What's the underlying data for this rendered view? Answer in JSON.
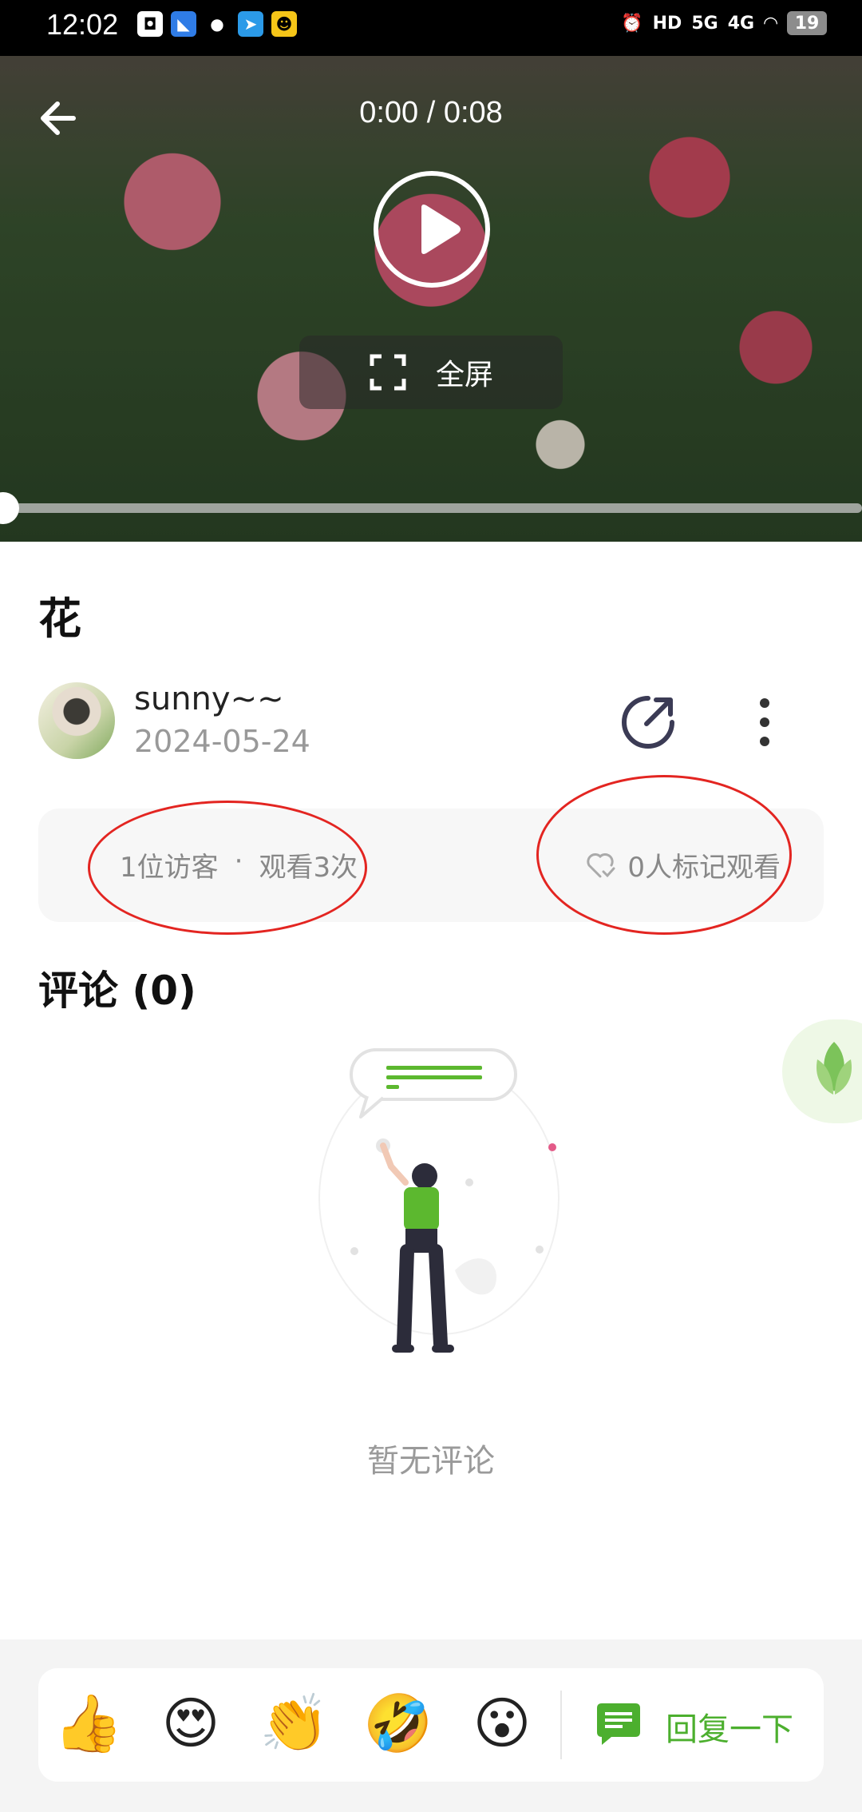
{
  "status_bar": {
    "time": "12:02",
    "signal_labels": [
      "HD",
      "5G",
      "4G"
    ],
    "battery": "19"
  },
  "video": {
    "time_display": "0:00 / 0:08",
    "fullscreen_label": "全屏",
    "progress": 0.0
  },
  "post": {
    "title": "花",
    "author": "sunny~~",
    "date": "2024-05-24"
  },
  "stats": {
    "visitors": "1位访客",
    "separator": "·",
    "views": "观看3次",
    "marked": "0人标记观看"
  },
  "comments": {
    "heading": "评论 (0)",
    "empty_text": "暂无评论"
  },
  "reactions": {
    "emojis": [
      "👍",
      "😍",
      "👏",
      "🤣",
      "😮"
    ],
    "reply_label": "回复一下"
  },
  "colors": {
    "accent_green": "#4caf2e",
    "annotation_red": "#e32521"
  }
}
